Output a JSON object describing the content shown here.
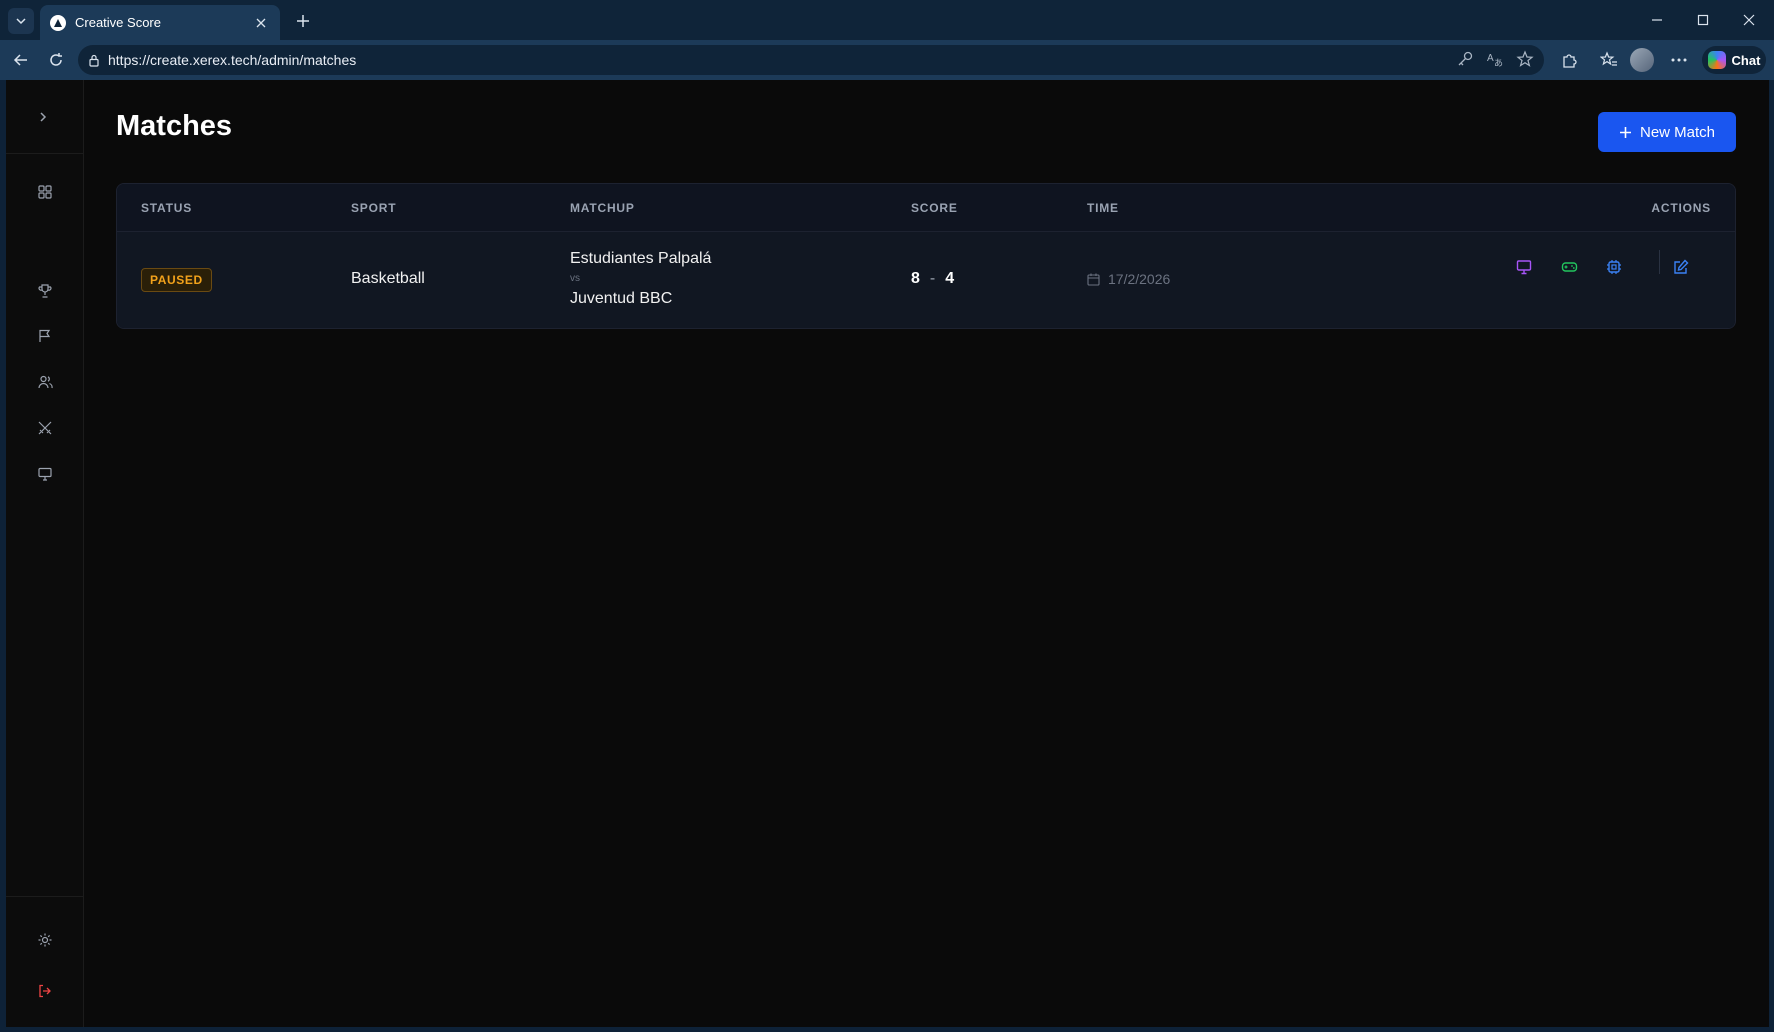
{
  "browser": {
    "tab_title": "Creative Score",
    "url": "https://create.xerex.tech/admin/matches",
    "chat_label": "Chat"
  },
  "sidebar": {
    "items": [
      {
        "icon": "chevron-right-icon"
      },
      {
        "icon": "dashboard-icon"
      },
      {
        "icon": "trophy-icon"
      },
      {
        "icon": "flag-icon"
      },
      {
        "icon": "users-icon"
      },
      {
        "icon": "swords-icon"
      },
      {
        "icon": "monitor-icon"
      }
    ],
    "bottom": [
      {
        "icon": "sun-icon"
      },
      {
        "icon": "logout-icon"
      }
    ]
  },
  "page": {
    "title": "Matches",
    "new_match_label": "New Match"
  },
  "table": {
    "headers": {
      "status": "STATUS",
      "sport": "SPORT",
      "matchup": "MATCHUP",
      "score": "SCORE",
      "time": "TIME",
      "actions": "ACTIONS"
    },
    "rows": [
      {
        "status": "PAUSED",
        "sport": "Basketball",
        "team1": "Estudiantes Palpalá",
        "vs": "vs",
        "team2": "Juventud BBC",
        "score_home": "8",
        "score_sep": "-",
        "score_away": "4",
        "date": "17/2/2026"
      }
    ]
  },
  "colors": {
    "accent": "#1a56f0",
    "status_paused": "#f2a21b",
    "action_display": "#a855f7",
    "action_controller": "#22c55e",
    "action_settings": "#3b82f6",
    "logout": "#ef4444"
  }
}
